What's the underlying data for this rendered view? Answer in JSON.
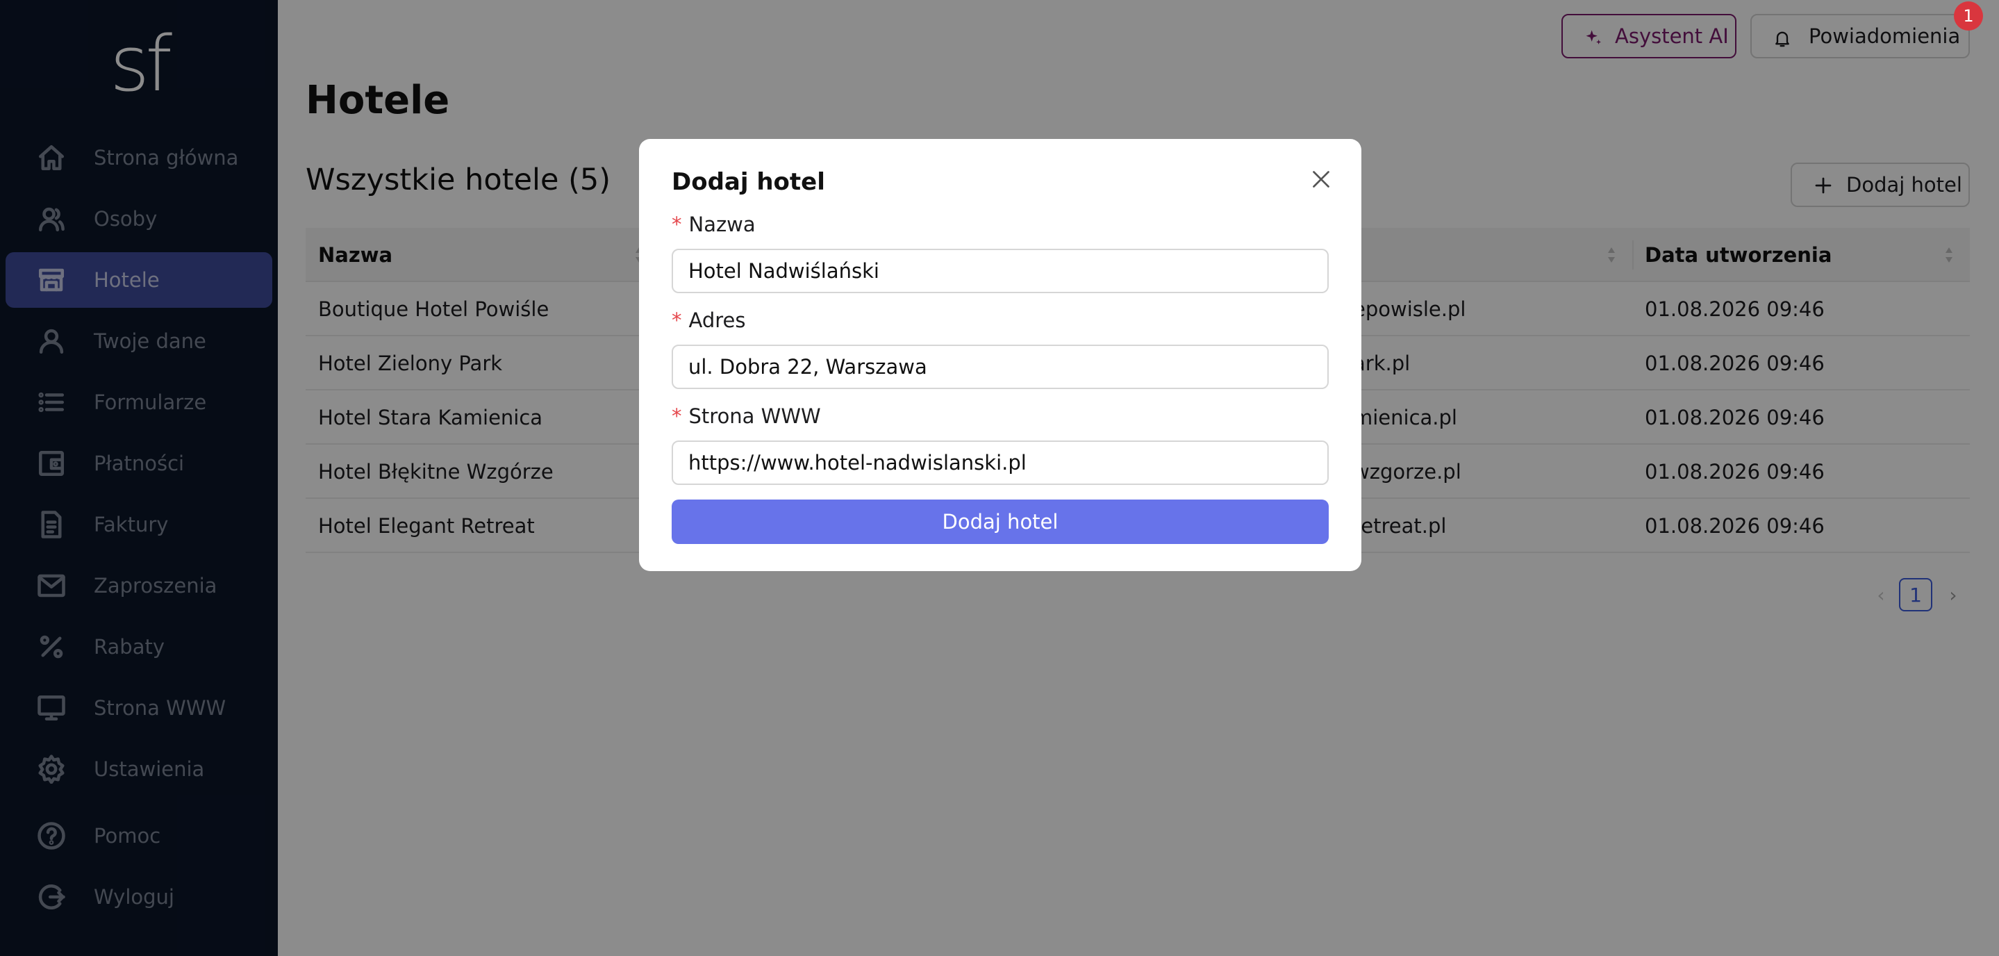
{
  "sidebar": {
    "logo": "sf",
    "items": [
      {
        "label": "Strona główna",
        "icon": "home-icon",
        "active": false
      },
      {
        "label": "Osoby",
        "icon": "people-icon",
        "active": false
      },
      {
        "label": "Hotele",
        "icon": "hotel-icon",
        "active": true
      },
      {
        "label": "Twoje dane",
        "icon": "user-icon",
        "active": false
      },
      {
        "label": "Formularze",
        "icon": "list-icon",
        "active": false
      },
      {
        "label": "Płatności",
        "icon": "wallet-icon",
        "active": false
      },
      {
        "label": "Faktury",
        "icon": "document-icon",
        "active": false
      },
      {
        "label": "Zaproszenia",
        "icon": "mail-icon",
        "active": false
      },
      {
        "label": "Rabaty",
        "icon": "percent-icon",
        "active": false
      },
      {
        "label": "Strona WWW",
        "icon": "monitor-icon",
        "active": false
      },
      {
        "label": "Ustawienia",
        "icon": "gear-icon",
        "active": false
      },
      {
        "label": "Pomoc",
        "icon": "help-icon",
        "active": false
      },
      {
        "label": "Wyloguj",
        "icon": "logout-icon",
        "active": false
      }
    ]
  },
  "header": {
    "ai_label": "Asystent AI",
    "notifications_label": "Powiadomienia",
    "notifications_count": "1"
  },
  "page": {
    "title": "Hotele",
    "section_title": "Wszystkie hotele (5)",
    "add_button": "Dodaj hotel"
  },
  "table": {
    "columns": [
      "Nazwa",
      "Data utworzenia"
    ],
    "rows": [
      {
        "name": "Boutique Hotel Powiśle",
        "www_visible": "epowisle.pl",
        "created": "01.08.2026 09:46"
      },
      {
        "name": "Hotel Zielony Park",
        "www_visible": "ark.pl",
        "created": "01.08.2026 09:46"
      },
      {
        "name": "Hotel Stara Kamienica",
        "www_visible": "mienica.pl",
        "created": "01.08.2026 09:46"
      },
      {
        "name": "Hotel Błękitne Wzgórze",
        "www_visible": "wzgorze.pl",
        "created": "01.08.2026 09:46"
      },
      {
        "name": "Hotel Elegant Retreat",
        "www_visible": "retreat.pl",
        "created": "01.08.2026 09:46"
      }
    ]
  },
  "pagination": {
    "prev": "‹",
    "current": "1",
    "next": "›"
  },
  "modal": {
    "title": "Dodaj hotel",
    "required_mark": "*",
    "fields": [
      {
        "label": "Nazwa",
        "value": "Hotel Nadwiślański"
      },
      {
        "label": "Adres",
        "value": "ul. Dobra 22, Warszawa"
      },
      {
        "label": "Strona WWW",
        "value": "https://www.hotel-nadwislanski.pl"
      }
    ],
    "submit_label": "Dodaj hotel"
  },
  "colors": {
    "sidebar_bg": "#0b1629",
    "sidebar_active": "#3e4b9b",
    "ai_accent": "#7a1a6c",
    "primary_button": "#6773ea",
    "badge": "#d9363e",
    "required": "#e5484d"
  }
}
